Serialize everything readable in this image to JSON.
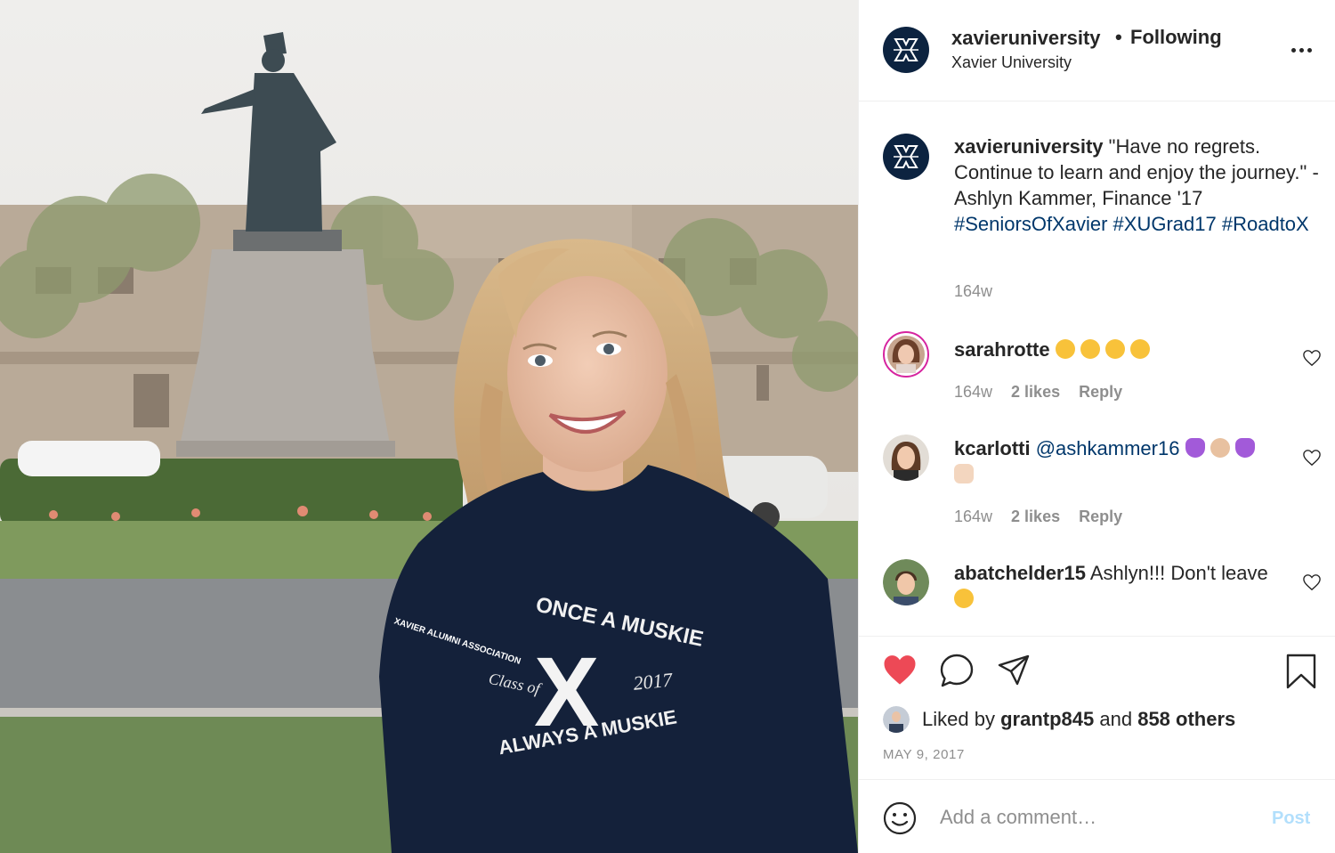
{
  "header": {
    "username": "xavieruniversity",
    "separator": "•",
    "follow_status": "Following",
    "subtitle": "Xavier University",
    "more_icon": "more-horizontal-icon"
  },
  "caption": {
    "username": "xavieruniversity",
    "text": "\"Have no regrets. Continue to learn and enjoy the journey.\" - Ashlyn Kammer, Finance '17",
    "hashtags": [
      "#SeniorsOfXavier",
      "#XUGrad17",
      "#RoadtoX"
    ],
    "time": "164w"
  },
  "comments": [
    {
      "username": "sarahrotte",
      "text": "",
      "emojis": [
        "heart-eyes",
        "heart-eyes",
        "heart-eyes",
        "heart-eyes"
      ],
      "time": "164w",
      "likes": "2 likes",
      "reply": "Reply"
    },
    {
      "username": "kcarlotti",
      "text": "@ashkammer16",
      "emojis": [
        "purple-heart",
        "ok-hand",
        "purple-heart",
        "thumbs-up"
      ],
      "time": "164w",
      "likes": "2 likes",
      "reply": "Reply"
    },
    {
      "username": "abatchelder15",
      "text": "Ashlyn!!! Don't leave",
      "emojis": [
        "crying-face"
      ]
    }
  ],
  "actions": {
    "liked_prefix": "Liked by",
    "liked_user": "grantp845",
    "liked_and": "and",
    "liked_others": "858 others",
    "date": "MAY 9, 2017"
  },
  "add_comment": {
    "placeholder": "Add a comment…",
    "post_label": "Post"
  },
  "photo": {
    "shirt_top": "ONCE A MUSKIE",
    "shirt_bottom": "ALWAYS A MUSKIE",
    "shirt_class": "Class of",
    "shirt_year": "2017",
    "shirt_letter": "X",
    "sleeve_text": "XAVIER ALUMNI ASSOCIATION"
  },
  "colors": {
    "xavier_navy": "#0c2340",
    "link_blue": "#00376b",
    "like_red": "#ed4956",
    "muted": "#8e8e8e",
    "post_disabled": "#b2dffc"
  }
}
